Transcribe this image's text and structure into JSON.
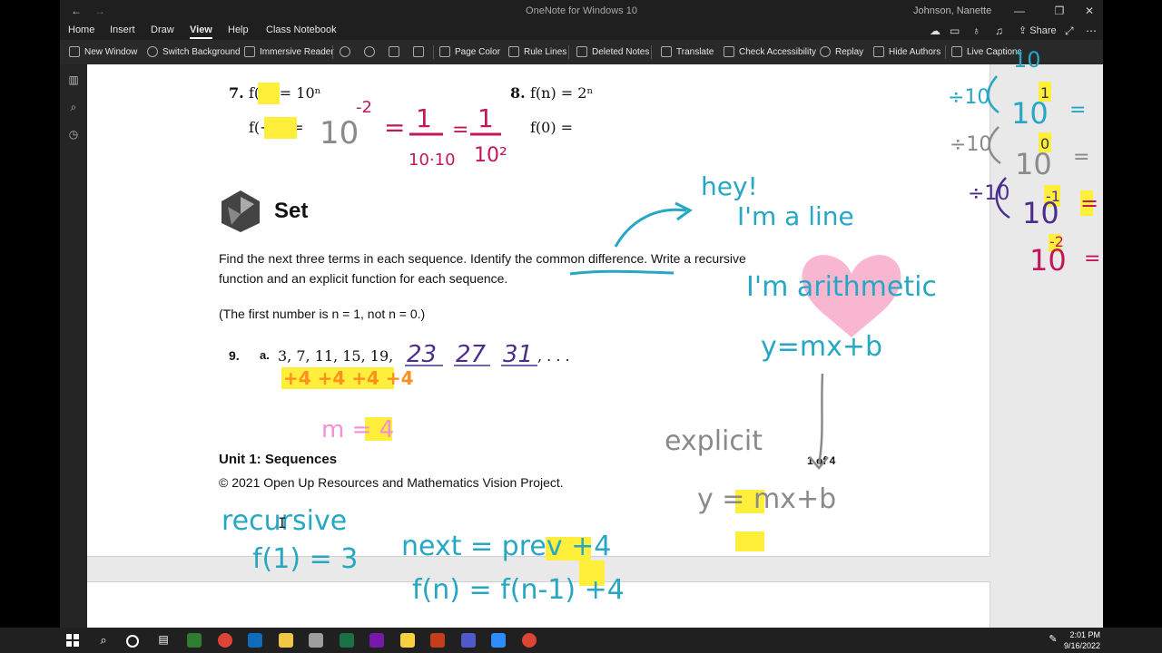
{
  "window": {
    "title": "OneNote for Windows 10",
    "user": "Johnson, Nanette"
  },
  "menu": {
    "items": [
      "Home",
      "Insert",
      "Draw",
      "View",
      "Help",
      "Class Notebook"
    ],
    "active": "View",
    "share": "Share"
  },
  "toolbar": {
    "new_window": "New Window",
    "switch_background": "Switch Background",
    "immersive_reader": "Immersive Reader",
    "page_color": "Page Color",
    "rule_lines": "Rule Lines",
    "deleted_notes": "Deleted Notes",
    "translate": "Translate",
    "check_accessibility": "Check Accessibility",
    "replay": "Replay",
    "hide_authors": "Hide Authors",
    "live_captions": "Live Captions"
  },
  "page": {
    "p7_num": "7.",
    "p7_fn": "f(n) = 10ⁿ",
    "p7_eval": "f(−2) =",
    "p8_num": "8.",
    "p8_fn": "f(n) = 2ⁿ",
    "p8_eval": "f(0) =",
    "set_title": "Set",
    "instructions_1": "Find the next three terms in each sequence. Identify the common difference. Write a recursive",
    "instructions_2": "function and an explicit function for each sequence.",
    "note": "(The first number is n = 1, not n = 0.)",
    "p9_num": "9.",
    "p9_part": "a.",
    "p9_seq": "3, 7, 11, 15, 19,",
    "p9_dots": ", . . .",
    "unit": "Unit 1: Sequences",
    "copyright": "© 2021 Open Up Resources and Mathematics Vision Project.",
    "page_of": "1 of 4"
  },
  "ink": {
    "ten": "10",
    "exp_neg2": "-2",
    "one": "1",
    "ten_ten": "10·10",
    "ten_sq": "10²",
    "hey": "hey!",
    "line": "I'm a line",
    "arith": "I'm arithmetic",
    "ymxb": "y=mx+b",
    "a23": "23",
    "a27": "27",
    "a31": "31",
    "plus4s": "+4 +4 +4 +4",
    "m4": "m = 4",
    "explicit": "explicit",
    "ymxb2": "y = mx+b",
    "recursive": "recursive",
    "f1": "f(1) = 3",
    "next": "next = prev +4",
    "fn": "f(n) = f(n-1) +4",
    "div10": "÷10",
    "side_1": "1",
    "side_0": "0",
    "side_m1": "-1",
    "side_m2": "-2",
    "eq": "="
  },
  "taskbar": {
    "time": "2:01 PM",
    "date": "9/16/2022"
  },
  "colors": {
    "magenta_ink": "#c2185b",
    "teal_ink": "#26a7c4",
    "purple_ink": "#4a2d8f",
    "gray_ink": "#8a8a8a",
    "highlight": "#ffef3b",
    "pink_heart": "#f7a9c8"
  }
}
